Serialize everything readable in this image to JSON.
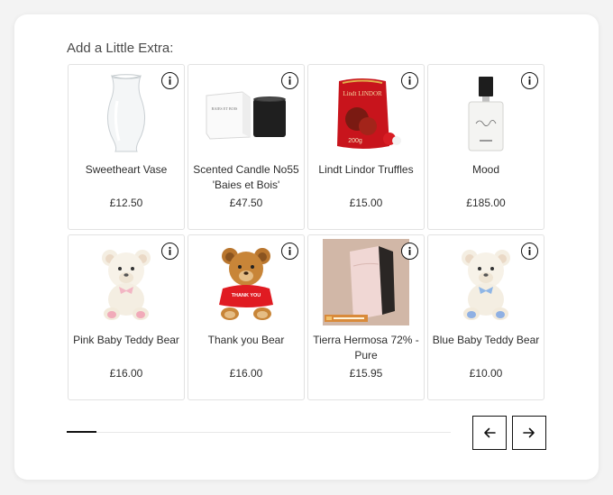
{
  "heading": "Add a Little Extra:",
  "products": [
    {
      "name": "Sweetheart Vase",
      "price": "£12.50",
      "image": "vase"
    },
    {
      "name": "Scented Candle No55 'Baies et Bois'",
      "price": "£47.50",
      "image": "candle",
      "label_text": "BAIES ET BOIS"
    },
    {
      "name": "Lindt Lindor Truffles",
      "price": "£15.00",
      "image": "truffles",
      "label_text": "Lindt LINDOR"
    },
    {
      "name": "Mood",
      "price": "£185.00",
      "image": "perfume"
    },
    {
      "name": "Pink Baby Teddy Bear",
      "price": "£16.00",
      "image": "pink-bear"
    },
    {
      "name": "Thank you Bear",
      "price": "£16.00",
      "image": "thankyou-bear",
      "label_text": "THANK YOU"
    },
    {
      "name": "Tierra Hermosa 72% - Pure",
      "price": "£15.95",
      "image": "chocolate"
    },
    {
      "name": "Blue Baby Teddy Bear",
      "price": "£10.00",
      "image": "blue-bear"
    }
  ],
  "icons": {
    "info": "info-icon",
    "prev": "arrow-left-icon",
    "next": "arrow-right-icon"
  },
  "colors": {
    "accent": "#111111",
    "background": "#f3f3f3",
    "card": "#ffffff",
    "border": "#e2e2e2"
  }
}
